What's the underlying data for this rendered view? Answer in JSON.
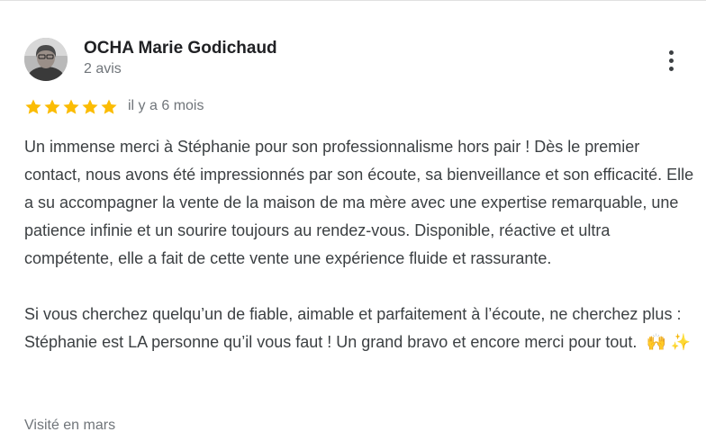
{
  "review": {
    "author_name": "OCHA Marie Godichaud",
    "author_reviews": "2 avis",
    "rating": 5,
    "rating_max": 5,
    "time": "il y a 6 mois",
    "paragraph_1": "Un immense merci à Stéphanie pour son professionnalisme hors pair ! Dès le premier contact, nous avons été impressionnés par son écoute, sa bienveillance et son efficacité. Elle a su accompagner la vente de la maison de ma mère avec une expertise remarquable, une patience infinie et un sourire toujours au rendez-vous. Disponible, réactive et ultra compétente, elle a fait de cette vente une expérience fluide et rassurante.",
    "paragraph_2": "Si vous cherchez quelqu’un de fiable, aimable et parfaitement à l’écoute, ne cherchez plus : Stéphanie est LA personne qu’il vous faut ! Un grand bravo et encore merci pour tout.",
    "emoji": "🙌 ✨",
    "visited": "Visité en mars"
  },
  "icons": {
    "star": "star-icon",
    "menu": "more-vert-icon"
  },
  "colors": {
    "star": "#fbbc04",
    "secondary_text": "#70757a",
    "primary_text": "#202124"
  }
}
